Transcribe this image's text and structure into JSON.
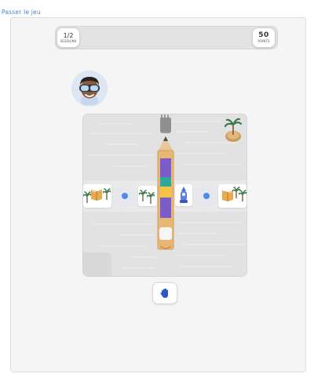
{
  "header": {
    "skip_label": "Passer le jeu"
  },
  "progress": {
    "sessions_value": "1/2",
    "sessions_label": "SESSIONS",
    "points_value": "50",
    "points_label": "POINTS"
  },
  "colors": {
    "accent": "#4a7fd4",
    "dot": "#4e8ce8",
    "pencil_body": "#e9b774",
    "segment_purple": "#7b5cc8",
    "segment_teal": "#2ea89c",
    "segment_yellow": "#f4c443"
  },
  "icons": {
    "player": "avatar-with-goggles-icon",
    "hand": "hand-icon",
    "island": "palm-island-icon",
    "eraser": "eraser-cap-icon",
    "tree": "palm-tree-icon",
    "book": "book-icon",
    "character": "small-character-icon"
  }
}
